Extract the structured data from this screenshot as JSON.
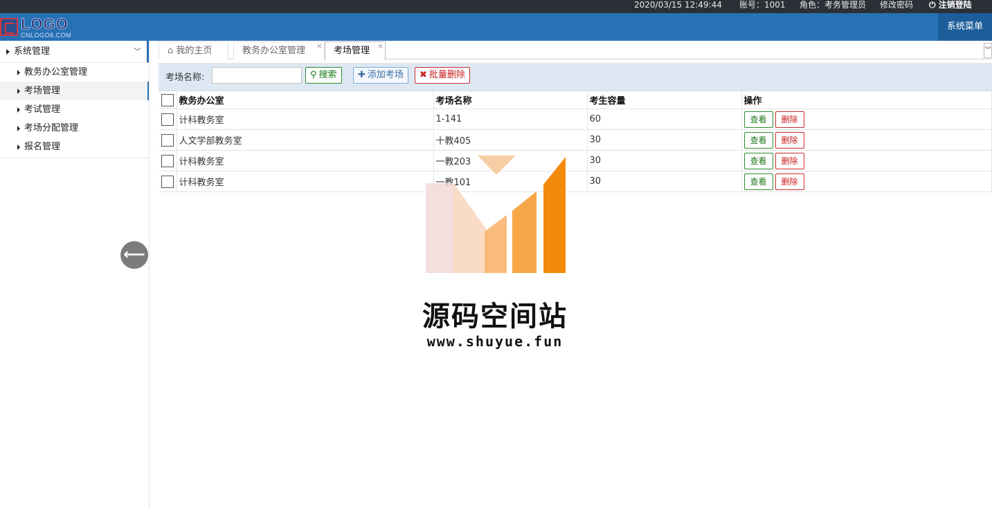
{
  "topbar": {
    "datetime": "2020/03/15 12:49:44",
    "account": "账号：1001",
    "role": "角色：考务管理员",
    "change_password": "修改密码",
    "logout": "注销登陆"
  },
  "header": {
    "logo_text": "LOGO",
    "logo_sub": "CNLOGO8.COM",
    "system_menu": "系统菜单"
  },
  "sidebar": {
    "group": "系统管理",
    "items": [
      {
        "label": "教务办公室管理"
      },
      {
        "label": "考场管理"
      },
      {
        "label": "考试管理"
      },
      {
        "label": "考场分配管理"
      },
      {
        "label": "报名管理"
      }
    ],
    "active_index": 1
  },
  "tabs": [
    {
      "label": "我的主页",
      "icon": "home-icon"
    },
    {
      "label": "教务办公室管理",
      "closable": true
    },
    {
      "label": "考场管理",
      "closable": true,
      "active": true
    }
  ],
  "toolbar": {
    "search_label": "考场名称:",
    "search_value": "",
    "search_button": "搜索",
    "add_button": "添加考场",
    "batch_delete_button": "批量删除"
  },
  "table": {
    "columns": [
      "教务办公室",
      "考场名称",
      "考生容量",
      "操作"
    ],
    "rows": [
      {
        "office": "计科教务室",
        "room": "1-141",
        "capacity": "60"
      },
      {
        "office": "人文学部教务室",
        "room": "十教405",
        "capacity": "30"
      },
      {
        "office": "计科教务室",
        "room": "一教203",
        "capacity": "30"
      },
      {
        "office": "计科教务室",
        "room": "一教101",
        "capacity": "30"
      }
    ],
    "view_label": "查看",
    "delete_label": "删除"
  },
  "watermark": {
    "title": "源码空间站",
    "url": "www.shuyue.fun"
  },
  "colors": {
    "header_blue": "#2771b5",
    "topbar_dark": "#2b2f36",
    "toolbar_bg": "#dde8f3",
    "green": "#2e8b2e",
    "red": "#c92a2a"
  }
}
